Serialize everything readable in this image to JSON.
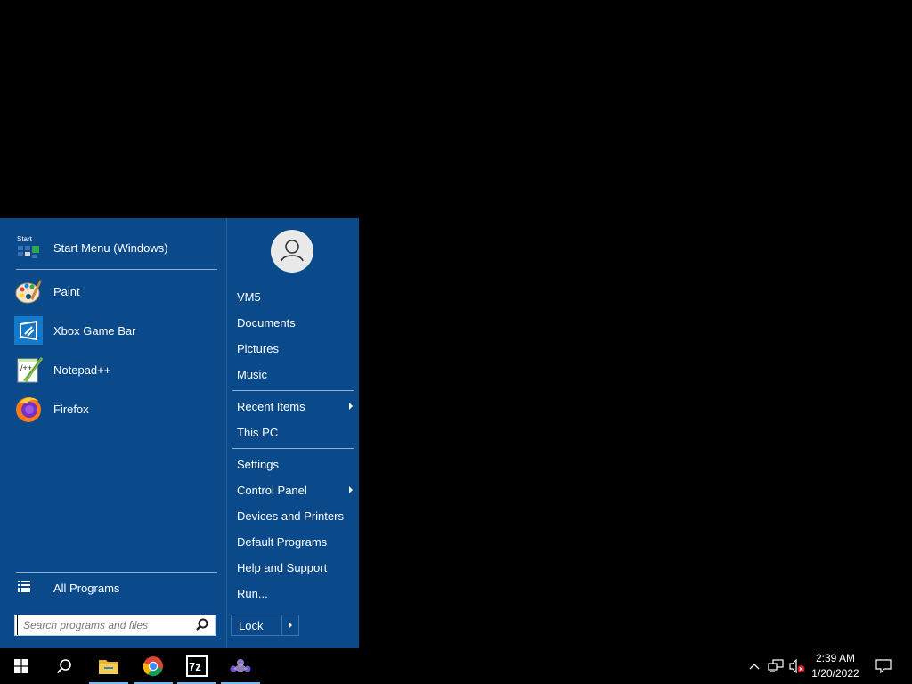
{
  "start_menu": {
    "pinned": {
      "label": "Start Menu (Windows)"
    },
    "programs": [
      {
        "label": "Paint",
        "icon": "paint-icon"
      },
      {
        "label": "Xbox Game Bar",
        "icon": "xbox-game-bar-icon"
      },
      {
        "label": "Notepad++",
        "icon": "notepadpp-icon"
      },
      {
        "label": "Firefox",
        "icon": "firefox-icon"
      }
    ],
    "all_programs": "All Programs",
    "search_placeholder": "Search programs and files",
    "right_items": [
      {
        "label": "VM5"
      },
      {
        "label": "Documents"
      },
      {
        "label": "Pictures"
      },
      {
        "label": "Music"
      },
      {
        "label": "Recent Items"
      },
      {
        "label": "This PC"
      },
      {
        "label": "Settings"
      },
      {
        "label": "Control Panel"
      },
      {
        "label": "Devices and Printers"
      },
      {
        "label": "Default Programs"
      },
      {
        "label": "Help and Support"
      },
      {
        "label": "Run..."
      }
    ],
    "lock_label": "Lock"
  },
  "taskbar": {
    "apps": [
      "start-icon",
      "search-icon",
      "file-explorer-icon",
      "chrome-icon",
      "7zip-icon",
      "app-icon"
    ],
    "clock": {
      "time": "2:39 AM",
      "date": "1/20/2022"
    }
  },
  "colors": {
    "menu_bg": "#0a4a8a",
    "taskbar_bg": "#000000",
    "accent": "#76b9ed"
  }
}
